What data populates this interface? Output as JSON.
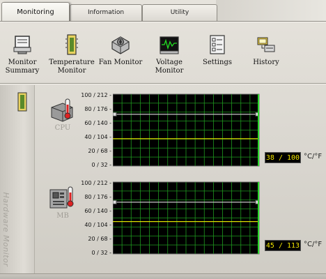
{
  "tabs": [
    {
      "label": "Monitoring",
      "active": true
    },
    {
      "label": "Information",
      "active": false
    },
    {
      "label": "Utility",
      "active": false
    }
  ],
  "toolbar": {
    "items": [
      {
        "label_line1": "Monitor",
        "label_line2": "Summary",
        "icon": "monitor-summary-icon"
      },
      {
        "label_line1": "Temperature",
        "label_line2": "Monitor",
        "icon": "temperature-monitor-icon"
      },
      {
        "label_line1": "Fan Monitor",
        "label_line2": "",
        "icon": "fan-monitor-icon"
      },
      {
        "label_line1": "Voltage",
        "label_line2": "Monitor",
        "icon": "voltage-monitor-icon"
      },
      {
        "label_line1": "Settings",
        "label_line2": "",
        "icon": "settings-icon"
      },
      {
        "label_line1": "History",
        "label_line2": "",
        "icon": "history-icon"
      }
    ]
  },
  "sidebar": {
    "title": "Hardware Monitor",
    "icon": "hardware-monitor-icon"
  },
  "scale_ticks": [
    "100 / 212 -",
    "80 / 176 -",
    "60 / 140 -",
    "40 / 104 -",
    "20 / 68 -",
    "0 / 32 -"
  ],
  "monitors": [
    {
      "name": "CPU",
      "icon": "cpu-thermometer-icon",
      "readout": "38 / 100",
      "unit": "°C/°F",
      "current_c": 38,
      "threshold_c": 72,
      "trace_color": "#e0e000",
      "threshold_color": "#c8c8c8"
    },
    {
      "name": "MB",
      "icon": "motherboard-icon",
      "readout": "45 / 113",
      "unit": "°C/°F",
      "current_c": 45,
      "threshold_c": 72,
      "trace_color": "#e0e000",
      "threshold_color": "#c8c8c8"
    }
  ],
  "colors": {
    "graph_background": "#000000",
    "grid": "#1f9a1f",
    "readout_text": "#f2e600"
  }
}
